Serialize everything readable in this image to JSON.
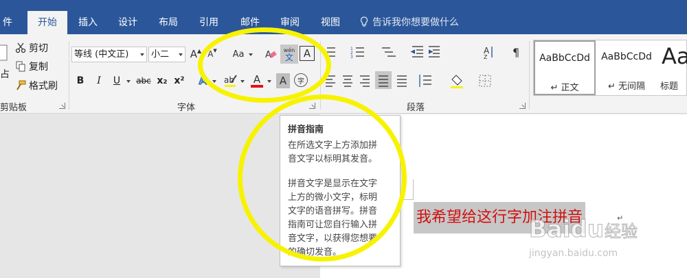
{
  "menu": {
    "tabs": [
      "件",
      "开始",
      "插入",
      "设计",
      "布局",
      "引用",
      "邮件",
      "审阅",
      "视图"
    ],
    "active_tab": "开始",
    "tell_me": "告诉我你想要做什么"
  },
  "ribbon": {
    "clipboard": {
      "paste_label": "占",
      "cut_label": "剪切",
      "copy_label": "复制",
      "format_painter_label": "格式刷",
      "group_label": "剪贴板"
    },
    "font": {
      "font_name": "等线 (中文正)",
      "font_size": "小二",
      "grow_label": "A",
      "shrink_label": "A",
      "change_case_label": "Aa",
      "phonetic_top": "wén",
      "phonetic_bottom": "文",
      "char_border_label": "A",
      "bold": "B",
      "italic": "I",
      "underline": "U",
      "strikethrough": "abc",
      "subscript": "x₂",
      "superscript": "x²",
      "text_effects": "A",
      "font_color_label": "A",
      "shading_label": "A",
      "enclose_label": "字",
      "group_label": "字体"
    },
    "paragraph": {
      "group_label": "段落"
    },
    "styles": {
      "items": [
        {
          "sample": "AaBbCcDd",
          "name": "↵ 正文"
        },
        {
          "sample": "AaBbCcDd",
          "name": "↵ 无间隔"
        },
        {
          "sample": "Aa",
          "name": "标题"
        }
      ]
    }
  },
  "tooltip": {
    "title": "拼音指南",
    "line1": "在所选文字上方添加拼",
    "line2": "音文字以标明其发音。",
    "line3": "拼音文字是显示在文字",
    "line4": "上方的微小文字，标明",
    "line5": "文字的语音拼写。拼音",
    "line6": "指南可让您自行输入拼",
    "line7": "音文字，以获得您想要",
    "line8": "的确切发音。"
  },
  "document": {
    "text": "我希望给这行字加注拼音",
    "para_mark": "↵"
  },
  "watermark": {
    "brand": "Baidu",
    "sub": "经验",
    "url": "jingyan.baidu.com"
  },
  "colors": {
    "ribbon_blue": "#2b579a",
    "highlight_yellow": "#f7f300",
    "doc_text_red": "#d01010",
    "font_color_red": "#e81010"
  }
}
